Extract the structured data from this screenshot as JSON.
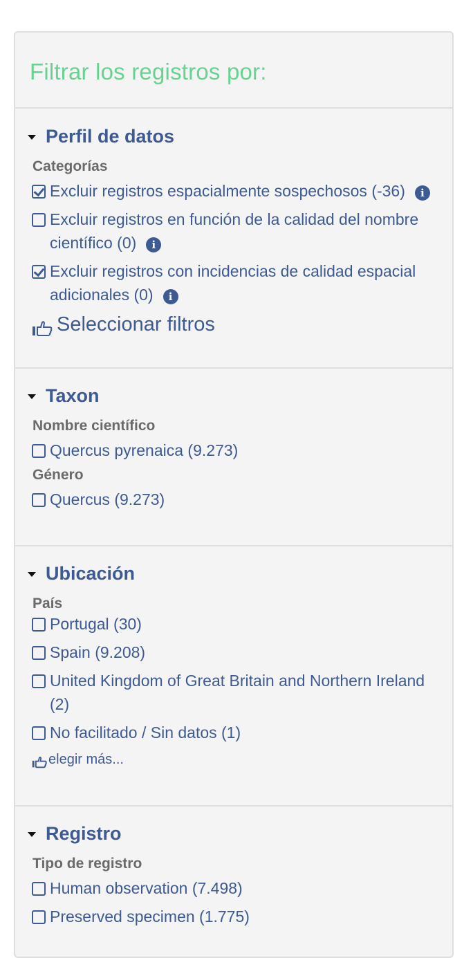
{
  "panel": {
    "title": "Filtrar los registros por:"
  },
  "sections": {
    "perfil": {
      "title": "Perfil de datos",
      "group": "Categorías",
      "items": [
        {
          "label": "Excluir registros espacialmente sospechosos (-36)",
          "checked": true
        },
        {
          "label": "Excluir registros en función de la calidad del nombre científico (0)",
          "checked": false
        },
        {
          "label": "Excluir registros con incidencias de calidad espacial adicionales (0)",
          "checked": true
        }
      ],
      "select_label": "Seleccionar filtros"
    },
    "taxon": {
      "title": "Taxon",
      "group1": "Nombre científico",
      "item1": "Quercus pyrenaica (9.273)",
      "group2": "Género",
      "item2": "Quercus (9.273)"
    },
    "ubicacion": {
      "title": "Ubicación",
      "group": "País",
      "items": [
        "Portugal (30)",
        "Spain (9.208)",
        "United Kingdom of Great Britain and Northern Ireland (2)",
        "No facilitado / Sin datos (1)"
      ],
      "more_label": "elegir más..."
    },
    "registro": {
      "title": "Registro",
      "group": "Tipo de registro",
      "items": [
        "Human observation (7.498)",
        "Preserved specimen (1.775)"
      ]
    }
  },
  "icons": {
    "checkbox": "checkbox-icon",
    "info": "info-icon",
    "hand": "hand-pointer-icon",
    "caret": "caret-down-icon"
  },
  "colors": {
    "accent": "#68d391",
    "link": "#3d5a92",
    "label": "#6a6a6a"
  }
}
